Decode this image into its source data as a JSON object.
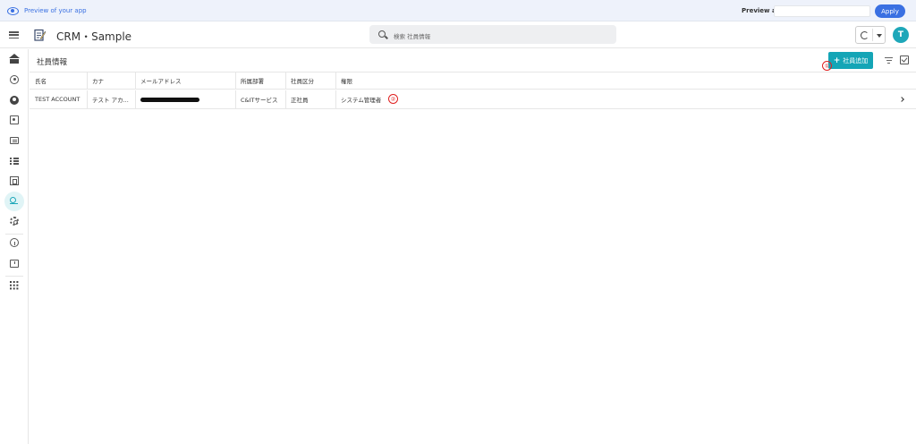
{
  "preview_bar": {
    "label": "Preview of your app",
    "preview_as_label": "Preview as:",
    "preview_as_value": "",
    "apply_label": "Apply"
  },
  "header": {
    "app_title": "CRM・Sample",
    "search_placeholder": "検索 社員情報",
    "avatar_letter": "T"
  },
  "sidebar": {
    "items": [
      {
        "icon": "home-icon"
      },
      {
        "icon": "account-circle-icon"
      },
      {
        "icon": "person-filled-icon"
      },
      {
        "icon": "contact-card-icon"
      },
      {
        "icon": "chat-icon"
      },
      {
        "icon": "checklist-icon"
      },
      {
        "icon": "newspaper-icon"
      },
      {
        "icon": "employee-edit-icon",
        "active": true
      },
      {
        "icon": "settings-icon"
      },
      {
        "icon": "info-icon"
      },
      {
        "icon": "feedback-icon"
      },
      {
        "icon": "apps-grid-icon"
      }
    ]
  },
  "page": {
    "title": "社員情報",
    "add_button_label": "社員追加",
    "marker_1": "①",
    "marker_2": "②"
  },
  "table": {
    "columns": [
      "氏名",
      "カナ",
      "メールアドレス",
      "所属部署",
      "社員区分",
      "権限"
    ],
    "rows": [
      {
        "name": "TEST ACCOUNT",
        "kana": "テスト アカ...",
        "email": "",
        "department": "C&ITサービス",
        "employee_type": "正社員",
        "role": "システム管理者"
      }
    ]
  },
  "colors": {
    "accent": "#14a5b6",
    "preview_blue": "#3a70e2",
    "annotation_red": "#e02020"
  }
}
